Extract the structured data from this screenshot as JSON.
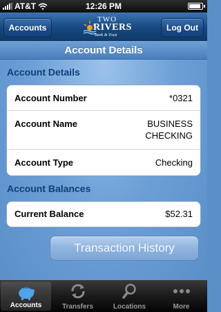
{
  "status_bar": {
    "carrier": "AT&T",
    "time": "12:26 PM",
    "icons": [
      "signal-icon",
      "wifi-icon",
      "battery-icon"
    ]
  },
  "nav": {
    "left_button": "Accounts",
    "right_button": "Log Out",
    "logo": {
      "line1": "TWO",
      "line2": "RIVERS",
      "line3": "Bank & Trust"
    }
  },
  "title": "Account Details",
  "details": {
    "heading": "Account Details",
    "rows": [
      {
        "label": "Account Number",
        "value": "*0321"
      },
      {
        "label": "Account Name",
        "value_line1": "BUSINESS",
        "value_line2": "CHECKING"
      },
      {
        "label": "Account Type",
        "value": "Checking"
      }
    ]
  },
  "balances": {
    "heading": "Account Balances",
    "rows": [
      {
        "label": "Current Balance",
        "value": "$52.31"
      }
    ]
  },
  "transaction_button": "Transaction History",
  "tabs": [
    {
      "label": "Accounts",
      "icon": "piggy-bank-icon",
      "active": true
    },
    {
      "label": "Transfers",
      "icon": "transfer-arrows-icon",
      "active": false
    },
    {
      "label": "Locations",
      "icon": "magnifier-icon",
      "active": false
    },
    {
      "label": "More",
      "icon": "more-dots-icon",
      "active": false
    }
  ],
  "colors": {
    "heading": "#0e3f7c",
    "nav_bar": "#17487f",
    "background": "#5a8fc8",
    "active_tab_icon": "#4fa3e8"
  }
}
